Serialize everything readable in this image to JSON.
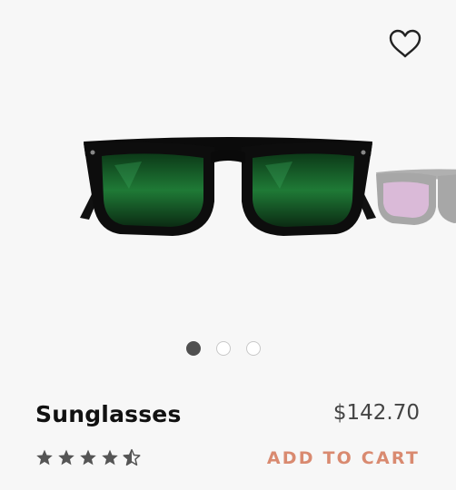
{
  "product": {
    "name": "Sunglasses",
    "price": "$142.70",
    "rating": 4.5,
    "rating_max": 5,
    "add_to_cart_label": "ADD TO CART"
  },
  "gallery": {
    "slide_count": 3,
    "active_slide": 0
  },
  "icons": {
    "favorite": "heart-outline-icon",
    "rating_full": "star-filled-icon",
    "rating_half": "star-half-icon"
  },
  "colors": {
    "background": "#f7f7f7",
    "accent": "#d98a70",
    "rating_star": "#555555",
    "active_dot": "#505050"
  }
}
